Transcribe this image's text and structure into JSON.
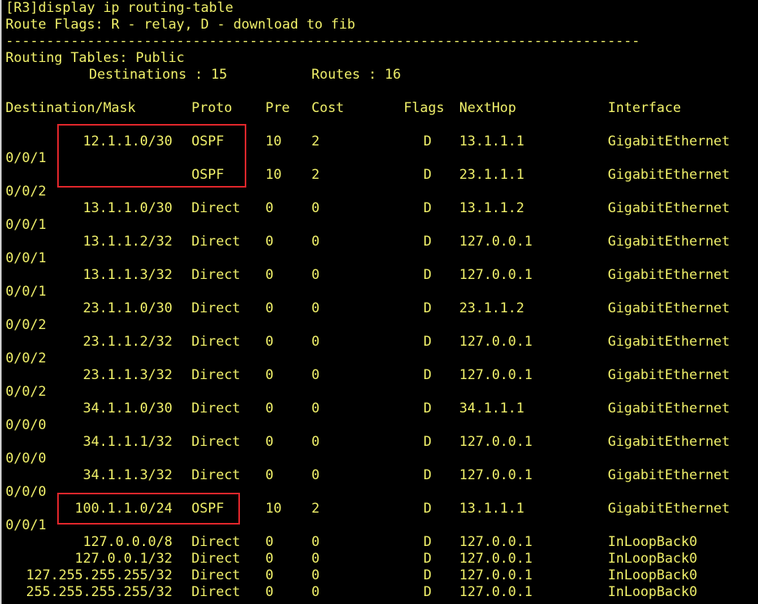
{
  "terminal": {
    "command_line": "[R3]display ip routing-table",
    "flags_line": "Route Flags: R - relay, D - download to fib",
    "separator": "------------------------------------------------------------------------------",
    "table_title": "Routing Tables: Public",
    "destinations_label": "Destinations : 15",
    "routes_label": "Routes : 16",
    "text_color": "#f0f06a",
    "background_color": "#000000",
    "highlight_color": "#e0262b"
  },
  "table": {
    "headers": {
      "destination": "Destination/Mask",
      "proto": "Proto",
      "pre": "Pre",
      "cost": "Cost",
      "flags": "Flags",
      "nexthop": "NextHop",
      "interface": "Interface"
    },
    "rows": [
      {
        "dest": "12.1.1.0/30",
        "proto": "OSPF",
        "pre": "10",
        "cost": "2",
        "flags": "D",
        "nexthop": "13.1.1.1",
        "iface": "GigabitEthernet",
        "cont": "0/0/1"
      },
      {
        "dest": "",
        "proto": "OSPF",
        "pre": "10",
        "cost": "2",
        "flags": "D",
        "nexthop": "23.1.1.1",
        "iface": "GigabitEthernet",
        "cont": "0/0/2"
      },
      {
        "dest": "13.1.1.0/30",
        "proto": "Direct",
        "pre": "0",
        "cost": "0",
        "flags": "D",
        "nexthop": "13.1.1.2",
        "iface": "GigabitEthernet",
        "cont": "0/0/1"
      },
      {
        "dest": "13.1.1.2/32",
        "proto": "Direct",
        "pre": "0",
        "cost": "0",
        "flags": "D",
        "nexthop": "127.0.0.1",
        "iface": "GigabitEthernet",
        "cont": "0/0/1"
      },
      {
        "dest": "13.1.1.3/32",
        "proto": "Direct",
        "pre": "0",
        "cost": "0",
        "flags": "D",
        "nexthop": "127.0.0.1",
        "iface": "GigabitEthernet",
        "cont": "0/0/1"
      },
      {
        "dest": "23.1.1.0/30",
        "proto": "Direct",
        "pre": "0",
        "cost": "0",
        "flags": "D",
        "nexthop": "23.1.1.2",
        "iface": "GigabitEthernet",
        "cont": "0/0/2"
      },
      {
        "dest": "23.1.1.2/32",
        "proto": "Direct",
        "pre": "0",
        "cost": "0",
        "flags": "D",
        "nexthop": "127.0.0.1",
        "iface": "GigabitEthernet",
        "cont": "0/0/2"
      },
      {
        "dest": "23.1.1.3/32",
        "proto": "Direct",
        "pre": "0",
        "cost": "0",
        "flags": "D",
        "nexthop": "127.0.0.1",
        "iface": "GigabitEthernet",
        "cont": "0/0/2"
      },
      {
        "dest": "34.1.1.0/30",
        "proto": "Direct",
        "pre": "0",
        "cost": "0",
        "flags": "D",
        "nexthop": "34.1.1.1",
        "iface": "GigabitEthernet",
        "cont": "0/0/0"
      },
      {
        "dest": "34.1.1.1/32",
        "proto": "Direct",
        "pre": "0",
        "cost": "0",
        "flags": "D",
        "nexthop": "127.0.0.1",
        "iface": "GigabitEthernet",
        "cont": "0/0/0"
      },
      {
        "dest": "34.1.1.3/32",
        "proto": "Direct",
        "pre": "0",
        "cost": "0",
        "flags": "D",
        "nexthop": "127.0.0.1",
        "iface": "GigabitEthernet",
        "cont": "0/0/0"
      },
      {
        "dest": "100.1.1.0/24",
        "proto": "OSPF",
        "pre": "10",
        "cost": "2",
        "flags": "D",
        "nexthop": "13.1.1.1",
        "iface": "GigabitEthernet",
        "cont": "0/0/1"
      },
      {
        "dest": "127.0.0.0/8",
        "proto": "Direct",
        "pre": "0",
        "cost": "0",
        "flags": "D",
        "nexthop": "127.0.0.1",
        "iface": "InLoopBack0",
        "cont": ""
      },
      {
        "dest": "127.0.0.1/32",
        "proto": "Direct",
        "pre": "0",
        "cost": "0",
        "flags": "D",
        "nexthop": "127.0.0.1",
        "iface": "InLoopBack0",
        "cont": ""
      },
      {
        "dest": "127.255.255.255/32",
        "proto": "Direct",
        "pre": "0",
        "cost": "0",
        "flags": "D",
        "nexthop": "127.0.0.1",
        "iface": "InLoopBack0",
        "cont": ""
      },
      {
        "dest": "255.255.255.255/32",
        "proto": "Direct",
        "pre": "0",
        "cost": "0",
        "flags": "D",
        "nexthop": "127.0.0.1",
        "iface": "InLoopBack0",
        "cont": ""
      }
    ]
  }
}
